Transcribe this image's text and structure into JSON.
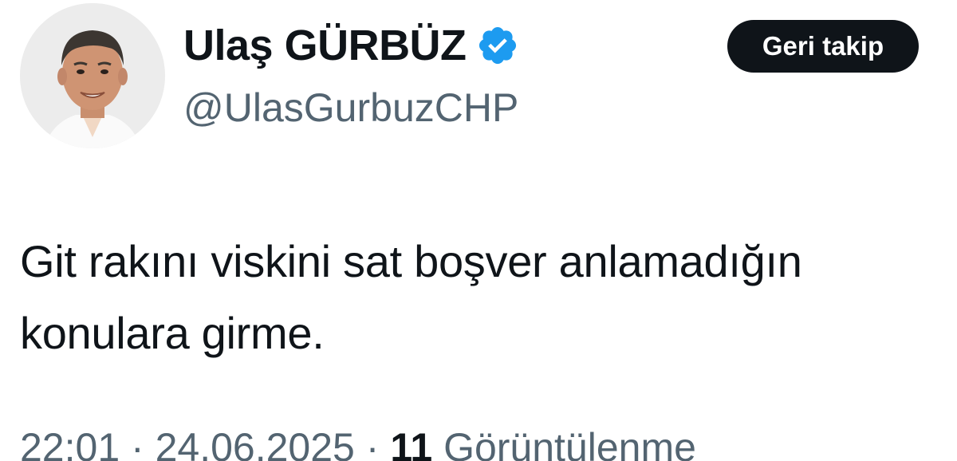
{
  "user": {
    "display_name": "Ulaş GÜRBÜZ",
    "handle": "@UlasGurbuzCHP",
    "verified_icon": "verified-badge-icon",
    "verified_color": "#1d9bf0"
  },
  "follow_button": {
    "label": "Geri takip"
  },
  "tweet": {
    "text": "Git rakını viskini sat boşver anlamadığın\nkonulara girme."
  },
  "meta": {
    "time": "22:01",
    "separator": "·",
    "date": "24.06.2025",
    "views_count": "11",
    "views_label": "Görüntülenme"
  },
  "colors": {
    "text_primary": "#0f1419",
    "text_secondary": "#536471",
    "button_bg": "#0f1419",
    "button_text": "#ffffff"
  }
}
